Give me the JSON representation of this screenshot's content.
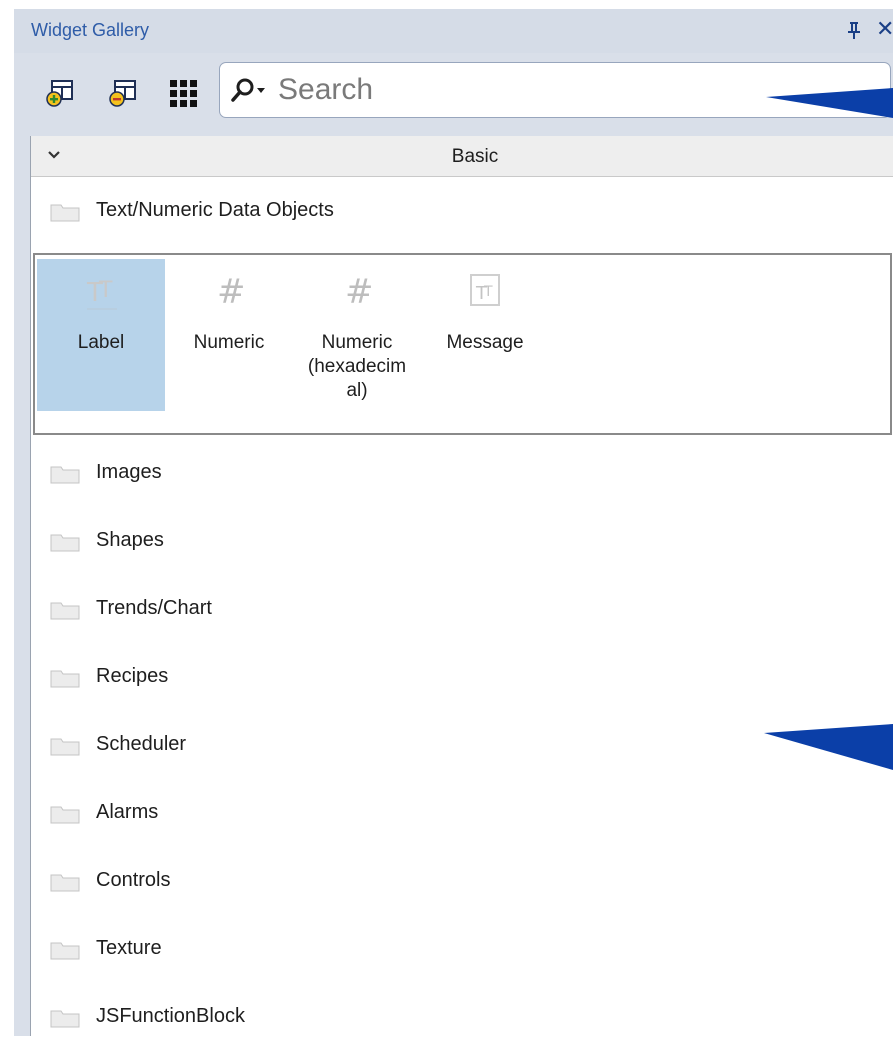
{
  "panel": {
    "title": "Widget Gallery",
    "pin_icon": "pin-icon",
    "close_icon": "close-icon"
  },
  "toolbar": {
    "buttons": [
      {
        "icon": "add-widget-icon"
      },
      {
        "icon": "remove-widget-icon"
      },
      {
        "icon": "grid-view-icon"
      }
    ],
    "search": {
      "placeholder": "Search",
      "value": "",
      "icon": "search-dropdown-icon"
    }
  },
  "gallery": {
    "section": {
      "title": "Basic",
      "expanded": true
    },
    "folders": [
      {
        "label": "Text/Numeric Data Objects",
        "expanded": true,
        "items": [
          {
            "label": "Label",
            "icon": "text-icon",
            "selected": true
          },
          {
            "label": "Numeric",
            "icon": "hash-icon",
            "selected": false
          },
          {
            "label": "Numeric\n(hexadecim\nal)",
            "icon": "hash-icon",
            "selected": false
          },
          {
            "label": "Message",
            "icon": "text-box-icon",
            "selected": false
          }
        ]
      },
      {
        "label": "Images"
      },
      {
        "label": "Shapes"
      },
      {
        "label": "Trends/Chart"
      },
      {
        "label": "Recipes"
      },
      {
        "label": "Scheduler"
      },
      {
        "label": "Alarms"
      },
      {
        "label": "Controls"
      },
      {
        "label": "Texture"
      },
      {
        "label": "JSFunctionBlock"
      }
    ]
  },
  "colors": {
    "title_text": "#2e5ca8",
    "panel_bg": "#d9dfe9",
    "selected_item": "#b7d3ea",
    "arrow": "#0b3fa8"
  }
}
